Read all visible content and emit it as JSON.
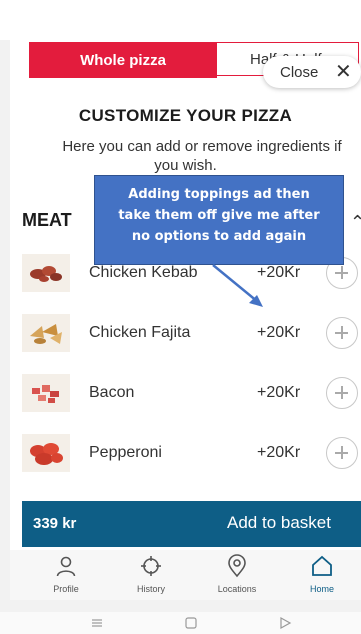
{
  "tabs": {
    "whole_label": "Whole pizza",
    "half_label": "Half & Half"
  },
  "close": {
    "label": "Close",
    "icon": "close-icon"
  },
  "header": {
    "title": "CUSTOMIZE YOUR PIZZA",
    "subtitle_line1": "Here you can add or remove ingredients if",
    "subtitle_line2": "you wish."
  },
  "section": {
    "name": "MEAT",
    "chevron_icon": "chevron-up-icon"
  },
  "toppings": [
    {
      "name": "Chicken Kebab",
      "price": "+20Kr",
      "thumb_icon": "chicken-kebab-thumbnail"
    },
    {
      "name": "Chicken Fajita",
      "price": "+20Kr",
      "thumb_icon": "chicken-fajita-thumbnail"
    },
    {
      "name": "Bacon",
      "price": "+20Kr",
      "thumb_icon": "bacon-thumbnail"
    },
    {
      "name": "Pepperoni",
      "price": "+20Kr",
      "thumb_icon": "pepperoni-thumbnail"
    }
  ],
  "basket": {
    "price": "339 kr",
    "label": "Add to basket"
  },
  "nav": [
    {
      "label": "Profile",
      "icon": "person-icon"
    },
    {
      "label": "History",
      "icon": "crosshair-icon"
    },
    {
      "label": "Locations",
      "icon": "location-pin-icon"
    },
    {
      "label": "Home",
      "icon": "home-icon"
    }
  ],
  "annotation": {
    "line1": "Adding toppings ad then",
    "line2": "take them off give me after",
    "line3": "no options to add again"
  },
  "colors": {
    "brand_red": "#e31c3d",
    "basket_blue": "#0e5e86",
    "annotation_blue": "#4472c4"
  }
}
